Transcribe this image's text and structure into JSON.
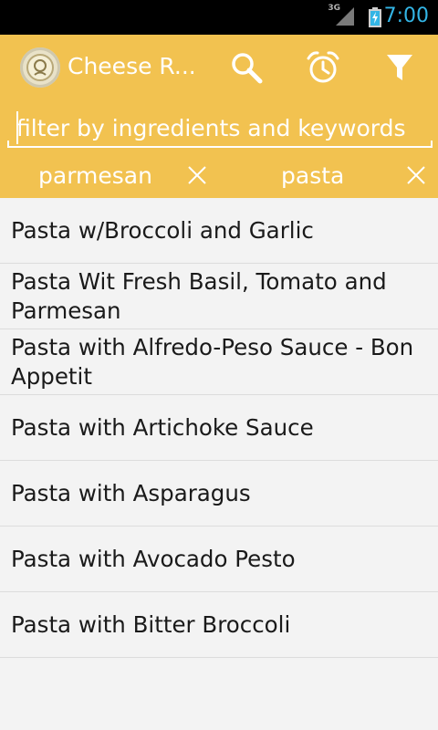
{
  "status_bar": {
    "network_label": "3G",
    "time": "7:00"
  },
  "action_bar": {
    "title": "Cheese R...",
    "icons": [
      "cheese-app-icon",
      "search-icon",
      "alarm-clock-icon",
      "filter-icon"
    ]
  },
  "filter": {
    "placeholder": "filter by ingredients and keywords",
    "value": "",
    "chips": [
      {
        "label": "parmesan",
        "icon": "close-icon"
      },
      {
        "label": "pasta",
        "icon": "close-icon"
      }
    ]
  },
  "results": {
    "items": [
      "Pasta w/Broccoli and Garlic",
      "Pasta Wit Fresh Basil, Tomato and Parmesan",
      "Pasta with Alfredo-Peso Sauce - Bon Appetit",
      "Pasta with Artichoke Sauce",
      "Pasta with Asparagus",
      "Pasta with Avocado Pesto",
      "Pasta with Bitter Broccoli"
    ]
  },
  "colors": {
    "accent": "#f2c250",
    "status_bar_bg": "#000000",
    "clock": "#33b5e5",
    "list_bg": "#f3f3f3"
  }
}
